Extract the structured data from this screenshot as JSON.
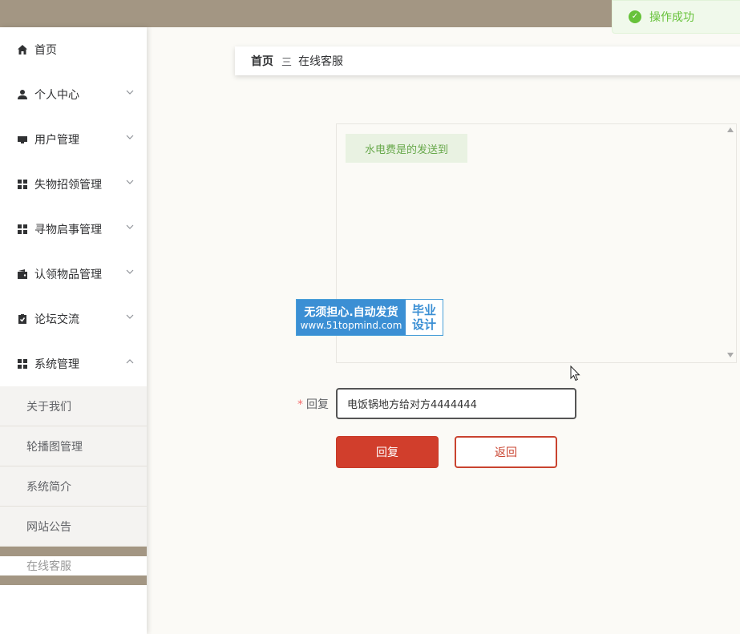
{
  "toast": {
    "message": "操作成功",
    "icon": "check-circle-icon"
  },
  "sidebar": {
    "items": [
      {
        "label": "首页",
        "icon": "home-icon",
        "has_children": false
      },
      {
        "label": "个人中心",
        "icon": "user-icon",
        "has_children": true
      },
      {
        "label": "用户管理",
        "icon": "users-icon",
        "has_children": true
      },
      {
        "label": "失物招领管理",
        "icon": "grid-icon",
        "has_children": true
      },
      {
        "label": "寻物启事管理",
        "icon": "grid-icon",
        "has_children": true
      },
      {
        "label": "认领物品管理",
        "icon": "wallet-icon",
        "has_children": true
      },
      {
        "label": "论坛交流",
        "icon": "clipboard-check-icon",
        "has_children": true
      },
      {
        "label": "系统管理",
        "icon": "grid-icon",
        "has_children": true,
        "expanded": true
      }
    ],
    "sub_items": [
      {
        "label": "关于我们"
      },
      {
        "label": "轮播图管理"
      },
      {
        "label": "系统简介"
      },
      {
        "label": "网站公告"
      },
      {
        "label": "在线客服",
        "active": true
      }
    ]
  },
  "breadcrumb": {
    "home": "首页",
    "separator": "三",
    "current": "在线客服"
  },
  "chat": {
    "messages": [
      {
        "text": "水电费是的发送到"
      }
    ]
  },
  "watermark": {
    "line1": "无须担心.自动发货",
    "line2": "www.51topmind.com",
    "right1": "毕业",
    "right2": "设计"
  },
  "form": {
    "reply_label": "回复",
    "required_mark": "*",
    "reply_value": "电饭锅地方给对方4444444",
    "reply_button": "回复",
    "back_button": "返回"
  },
  "colors": {
    "topbar": "#a39683",
    "primary": "#d13e2c",
    "success": "#67c23a"
  }
}
